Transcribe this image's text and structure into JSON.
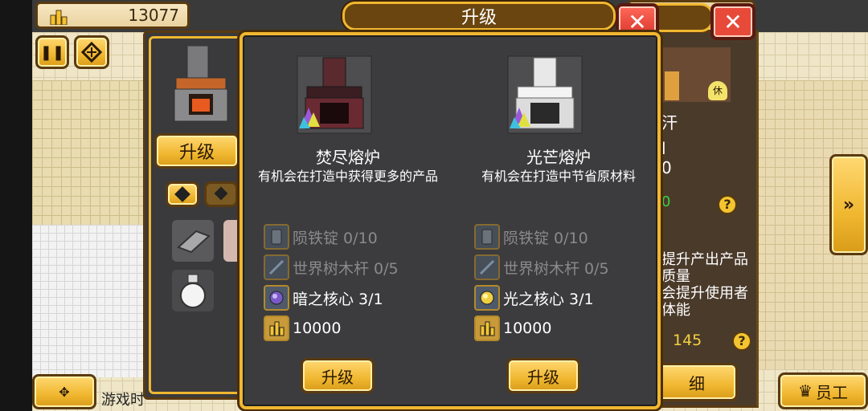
{
  "top_bar": {
    "money": "13077"
  },
  "background": {
    "left_panel": {
      "upgrade_label": "升级"
    },
    "right_panel": {
      "lines": [
        "汗",
        "l",
        "0",
        "0"
      ],
      "desc": "提升产出产品质量\n会提升使用者体能",
      "value": "145",
      "detail_label": "细",
      "staff_label": "员工"
    },
    "footer_text": "游戏时"
  },
  "dialog": {
    "title": "升级",
    "options": [
      {
        "name": "焚尽熔炉",
        "desc": "有机会在打造中获得更多的产品",
        "requirements": [
          {
            "icon": "ingot-icon",
            "label": "陨铁锭 0/10",
            "met": false
          },
          {
            "icon": "rod-icon",
            "label": "世界树木杆 0/5",
            "met": false
          },
          {
            "icon": "dark-core-icon",
            "label": "暗之核心 3/1",
            "met": true
          },
          {
            "icon": "coin-icon",
            "label": "10000",
            "met": true
          }
        ],
        "button_label": "升级"
      },
      {
        "name": "光芒熔炉",
        "desc": "有机会在打造中节省原材料",
        "requirements": [
          {
            "icon": "ingot-icon",
            "label": "陨铁锭 0/10",
            "met": false
          },
          {
            "icon": "rod-icon",
            "label": "世界树木杆 0/5",
            "met": false
          },
          {
            "icon": "light-core-icon",
            "label": "光之核心 3/1",
            "met": true
          },
          {
            "icon": "coin-icon",
            "label": "10000",
            "met": true
          }
        ],
        "button_label": "升级"
      }
    ]
  },
  "colors": {
    "gold": "#f0b730",
    "panel": "#3c3c3e",
    "close_red": "#e84a3a",
    "dim_text": "#8a8a8c"
  }
}
